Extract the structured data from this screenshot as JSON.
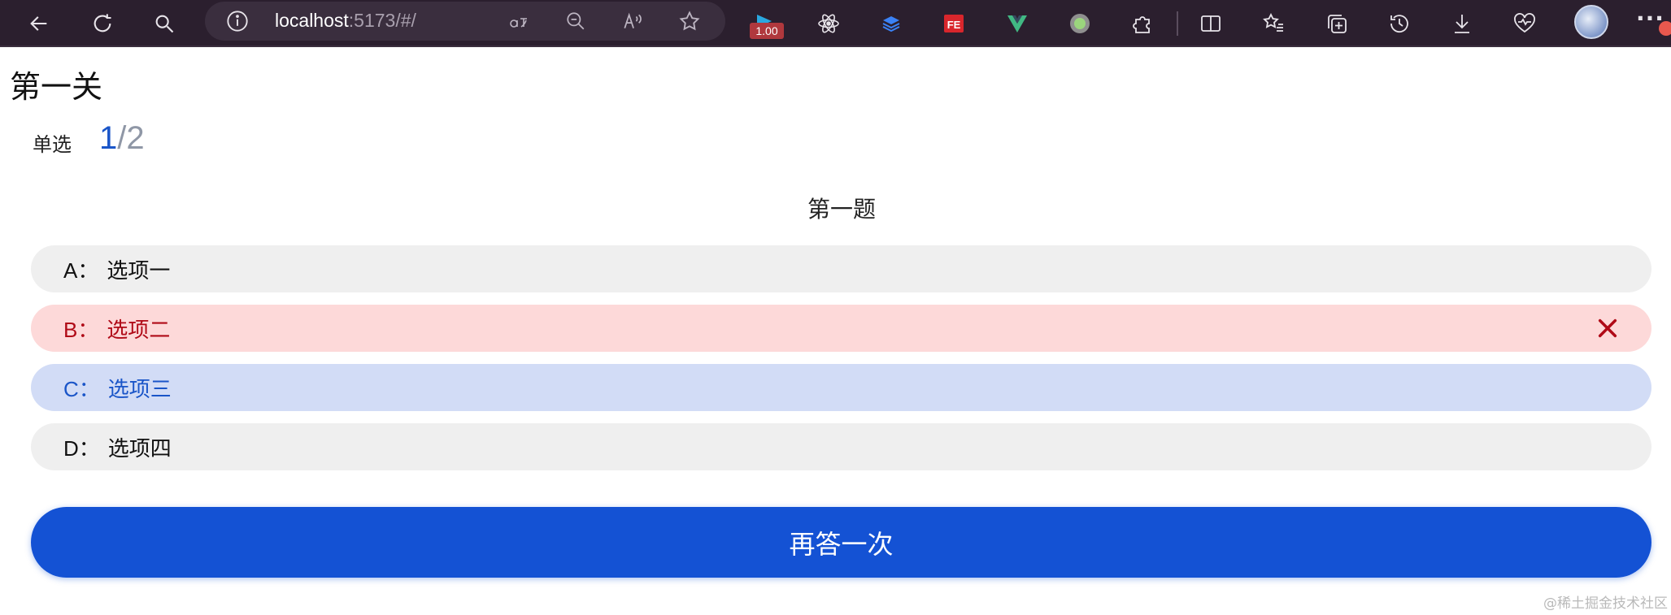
{
  "browser": {
    "url_host": "localhost",
    "url_rest": ":5173/#/",
    "badge_value": "1.00"
  },
  "page": {
    "title": "第一关",
    "question_type": "单选",
    "progress": {
      "current": "1",
      "slash": "/",
      "total": "2"
    },
    "question_title": "第一题",
    "options": [
      {
        "key": "A：",
        "text": "选项一",
        "state": "default"
      },
      {
        "key": "B：",
        "text": "选项二",
        "state": "wrong"
      },
      {
        "key": "C：",
        "text": "选项三",
        "state": "correct"
      },
      {
        "key": "D：",
        "text": "选项四",
        "state": "default"
      }
    ],
    "retry_label": "再答一次",
    "watermark": "@稀土掘金技术社区"
  },
  "colors": {
    "primary": "#1452d4",
    "wrong_bg": "#fdd9d9",
    "wrong_text": "#b00a17",
    "correct_bg": "#d2dcf6",
    "toolbar_bg": "#2b1f2e"
  },
  "icons": [
    "back-icon",
    "refresh-icon",
    "search-icon",
    "info-icon",
    "read-aloud-icon",
    "zoom-out-icon",
    "font-icon",
    "favorite-star-icon",
    "wrong-x-icon"
  ]
}
